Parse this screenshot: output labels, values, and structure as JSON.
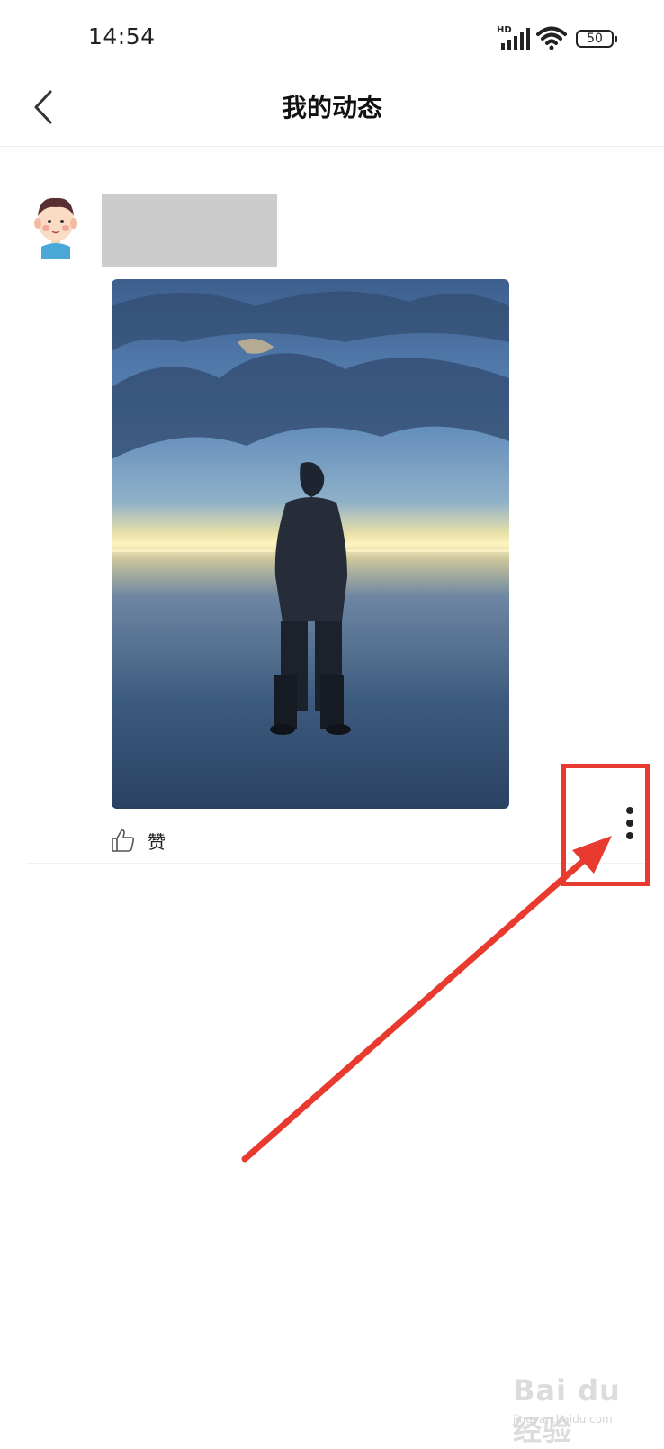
{
  "status_bar": {
    "time": "14:54",
    "network_type": "HD",
    "battery_level": "50",
    "icons": [
      "signal-icon",
      "wifi-icon",
      "battery-icon"
    ]
  },
  "nav": {
    "title": "我的动态",
    "back_icon": "chevron-left-icon"
  },
  "post": {
    "avatar_icon": "cartoon-boy-avatar",
    "image_description_icon": "photo",
    "like_label": "赞",
    "like_icon": "thumbs-up-icon",
    "more_icon": "vertical-dots-icon"
  },
  "annotation": {
    "highlight_color": "#e83a2e"
  },
  "watermark": {
    "main": "Bai du 经验",
    "sub": "jingyan.baidu.com"
  }
}
